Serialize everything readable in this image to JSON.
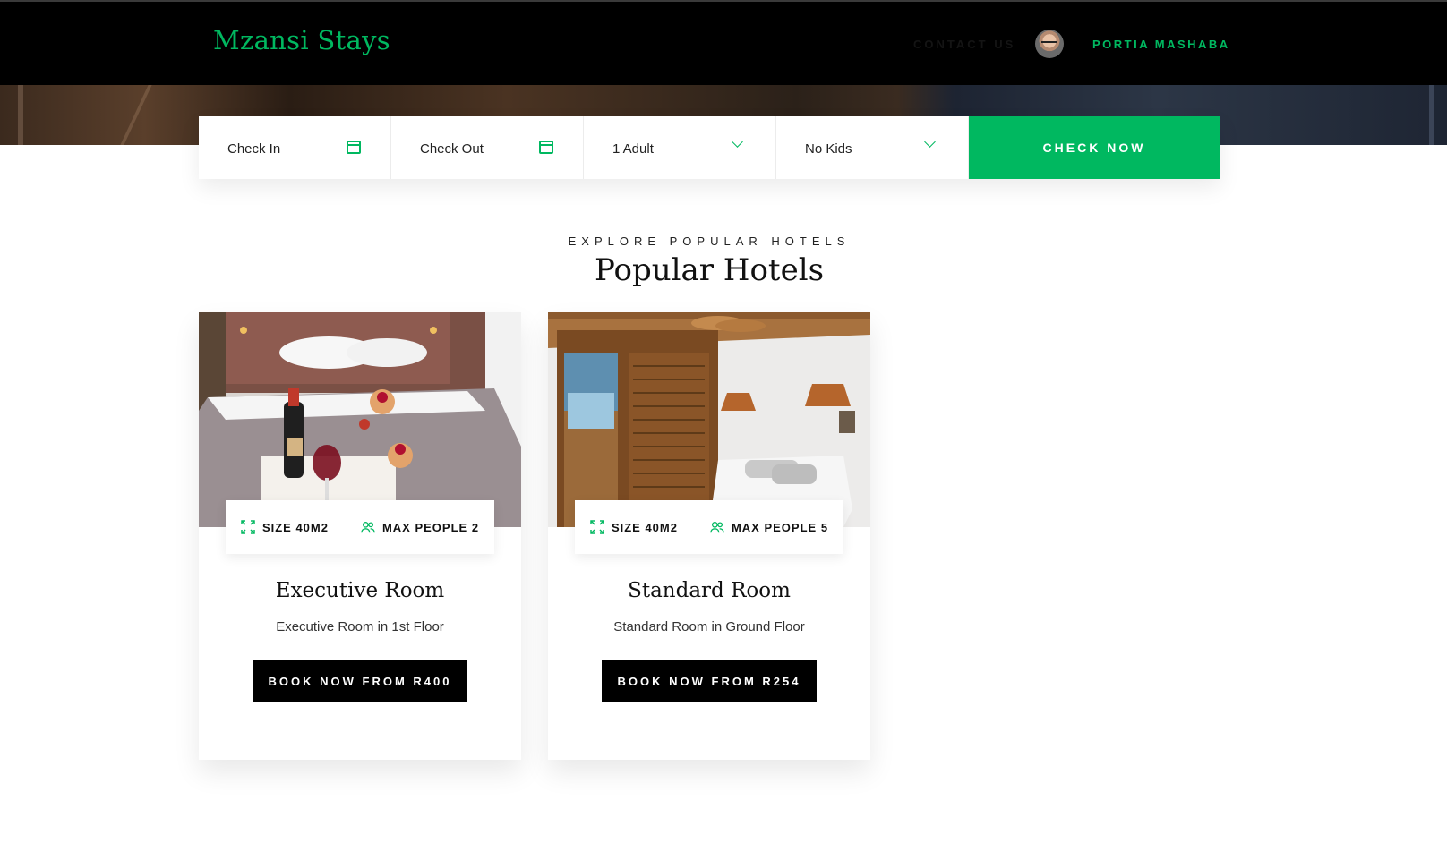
{
  "header": {
    "brand": "Mzansi Stays",
    "contact_label": "CONTACT US",
    "user_name": "PORTIA MASHABA"
  },
  "booking": {
    "check_in": "Check In",
    "check_out": "Check Out",
    "adults": "1 Adult",
    "kids": "No Kids",
    "submit": "CHECK NOW"
  },
  "section": {
    "eyebrow": "EXPLORE POPULAR HOTELS",
    "title": "Popular Hotels"
  },
  "rooms": [
    {
      "size": "SIZE 40M2",
      "max_people": "MAX PEOPLE 2",
      "title": "Executive Room",
      "description": "Executive Room in 1st Floor",
      "cta": "BOOK NOW FROM R400"
    },
    {
      "size": "SIZE 40M2",
      "max_people": "MAX PEOPLE 5",
      "title": "Standard Room",
      "description": "Standard Room in Ground Floor",
      "cta": "BOOK NOW FROM R254"
    }
  ],
  "colors": {
    "accent": "#00b860",
    "header_bg": "#000000",
    "button_dark": "#000000"
  },
  "icons": [
    "calendar-icon",
    "chevron-down-icon",
    "expand-icon",
    "people-icon",
    "avatar"
  ]
}
